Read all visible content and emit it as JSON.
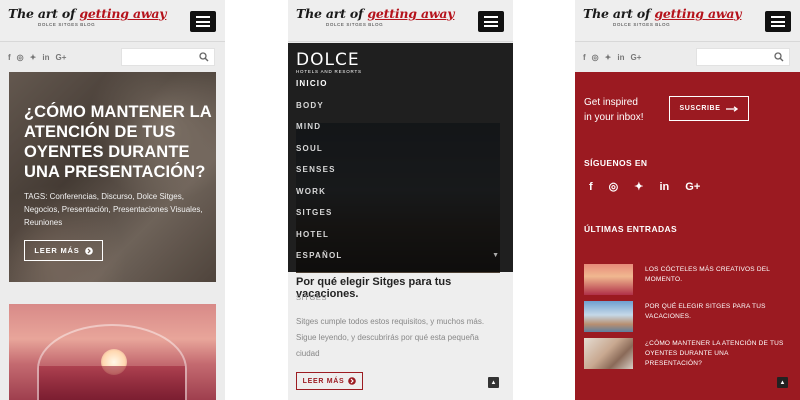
{
  "brand": {
    "logo_text_a": "The art of ",
    "logo_text_b": "getting away",
    "logo_sub": "DOLCE SITGES BLOG"
  },
  "social": [
    "f",
    "◎",
    "✦",
    "in",
    "G+"
  ],
  "screen1": {
    "hero": {
      "title": "¿CÓMO MANTENER LA ATENCIÓN DE TUS OYENTES DURANTE UNA PRESENTACIÓN?",
      "tags": "TAGS: Conferencias, Discurso, Dolce Sitges, Negocios, Presentación, Presentaciones Visuales, Reuniones",
      "button": "LEER MÁS"
    }
  },
  "screen2": {
    "menu": {
      "logo_main": "DOLCE",
      "logo_sub": "HOTELS AND RESORTS",
      "items": [
        "INICIO",
        "BODY",
        "MIND",
        "SOUL",
        "SENSES",
        "WORK",
        "SITGES",
        "HOTEL",
        "ESPAÑOL"
      ]
    },
    "post": {
      "title": "Por qué elegir Sitges para tus vacaciones.",
      "category": "SITGES",
      "excerpt": "Sitges cumple todos estos requisitos, y muchos más. Sigue leyendo, y descubrirás por qué esta pequeña ciudad",
      "button": "LEER MÁS"
    }
  },
  "screen3": {
    "newsletter": {
      "line1": "Get inspired",
      "line2": "in your inbox!",
      "button": "SUSCRIBE"
    },
    "follow_title": "SÍGUENOS EN",
    "entries_title": "ÚLTIMAS ENTRADAS",
    "entries": [
      "LOS CÓCTELES MÁS CREATIVOS DEL MOMENTO.",
      "POR QUÉ ELEGIR SITGES PARA TUS VACACIONES.",
      "¿CÓMO MANTENER LA ATENCIÓN DE TUS OYENTES DURANTE UNA PRESENTACIÓN?"
    ]
  },
  "colors": {
    "accent_red": "#9b1a21",
    "menu_black": "#080808",
    "page_gray": "#ececec"
  }
}
